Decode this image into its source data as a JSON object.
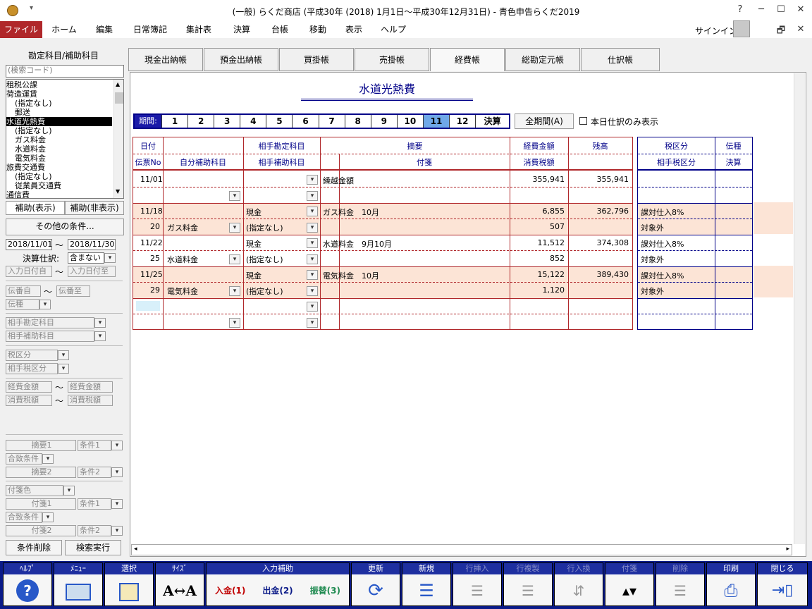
{
  "window": {
    "title": "(一般) らくだ商店 (平成30年 (2018) 1月1日～平成30年12月31日) - 青色申告らくだ2019",
    "buttons": {
      "help": "?",
      "min": "─",
      "max": "☐",
      "close": "✕"
    }
  },
  "menubar": {
    "items": [
      "ファイル",
      "ホーム",
      "編集",
      "日常簿記",
      "集計表",
      "決算",
      "台帳",
      "移動",
      "表示",
      "ヘルプ"
    ],
    "signin": "サインイン",
    "restore": "🗗",
    "close": "✕"
  },
  "left": {
    "header": "勘定科目/補助科目",
    "search_placeholder": "(検索コード)",
    "accounts": [
      "租税公課",
      "荷造運賃",
      "(指定なし)",
      "郵送",
      "水道光熱費",
      "(指定なし)",
      "ガス料金",
      "水道料金",
      "電気料金",
      "旅費交通費",
      "(指定なし)",
      "従業員交通費",
      "通信費"
    ],
    "selected_index": 4,
    "tab_show": "補助(表示)",
    "tab_hide": "補助(非表示)",
    "other_conditions": "その他の条件...",
    "date_from": "2018/11/01",
    "date_to": "2018/11/30",
    "tilde": "～",
    "kessan_label": "決算仕訳:",
    "kessan_value": "含まない",
    "input_date_from": "入力日付自",
    "input_date_to": "入力日付至",
    "denban_from": "伝番自",
    "denban_to": "伝番至",
    "denshu": "伝種",
    "aite_kamoku": "相手勘定科目",
    "aite_hojo": "相手補助科目",
    "zeikubun": "税区分",
    "aite_zeikubun": "相手税区分",
    "keihi_from": "経費金額",
    "keihi_to": "経費金額",
    "shohizei_from": "消費税額",
    "shohizei_to": "消費税額",
    "tekiyo1": "摘要1",
    "joken1": "条件1",
    "gatchi1": "合致条件",
    "tekiyo2": "摘要2",
    "joken2": "条件2",
    "fusen_color": "付箋色",
    "fusen1": "付箋1",
    "fusen_joken1": "条件1",
    "fusen_gatchi": "合致条件",
    "fusen2": "付箋2",
    "fusen_joken2": "条件2",
    "clear_button": "条件削除",
    "search_button": "検索実行"
  },
  "tabs": [
    "現金出納帳",
    "預金出納帳",
    "買掛帳",
    "売掛帳",
    "経費帳",
    "総勘定元帳",
    "仕訳帳"
  ],
  "active_tab": 4,
  "ledger_title": "水道光熱費",
  "period": {
    "label": "期間:",
    "cells": [
      "1",
      "2",
      "3",
      "4",
      "5",
      "6",
      "7",
      "8",
      "9",
      "10",
      "11",
      "12",
      "決算"
    ],
    "selected": "11",
    "all_button": "全期間(A)",
    "today_only": "本日仕訳のみ表示"
  },
  "headers": {
    "date": "日付",
    "denpyo": "伝票No",
    "self_hojo": "自分補助科目",
    "aite_kamoku": "相手勘定科目",
    "aite_hojo": "相手補助科目",
    "tekiyo": "摘要",
    "fusen": "付箋",
    "keihi": "経費金額",
    "shohizei": "消費税額",
    "zandaka": "残高",
    "zeikubun": "税区分",
    "aite_zeikubun": "相手税区分",
    "denshu": "伝種",
    "kessan": "決算"
  },
  "rows": [
    {
      "date": "11/01",
      "no": "",
      "self_hojo": "",
      "aite": "",
      "aite_hojo": "",
      "tekiyo": "繰越金額",
      "keihi": "355,941",
      "tax": "",
      "balance": "355,941",
      "zei": "",
      "aite_zei": ""
    },
    {
      "date": "11/18",
      "no": "20",
      "self_hojo": "ガス料金",
      "aite": "現金",
      "aite_hojo": "(指定なし)",
      "tekiyo": "ガス料金　10月",
      "keihi": "6,855",
      "tax": "507",
      "balance": "362,796",
      "zei": "課対仕入8%",
      "aite_zei": "対象外"
    },
    {
      "date": "11/22",
      "no": "25",
      "self_hojo": "水道料金",
      "aite": "現金",
      "aite_hojo": "(指定なし)",
      "tekiyo": "水道料金　9月10月",
      "keihi": "11,512",
      "tax": "852",
      "balance": "374,308",
      "zei": "課対仕入8%",
      "aite_zei": "対象外"
    },
    {
      "date": "11/25",
      "no": "29",
      "self_hojo": "電気料金",
      "aite": "現金",
      "aite_hojo": "(指定なし)",
      "tekiyo": "電気料金　10月",
      "keihi": "15,122",
      "tax": "1,120",
      "balance": "389,430",
      "zei": "課対仕入8%",
      "aite_zei": "対象外"
    }
  ],
  "toolbar": {
    "help": "ﾍﾙﾌﾟ",
    "menu": "ﾒﾆｭｰ",
    "select": "選択",
    "size": "ｻｲｽﾞ",
    "input_assist": "入力補助",
    "nyukin": "入金(1)",
    "shukkin": "出金(2)",
    "furikae": "振替(3)",
    "update": "更新",
    "new": "新規",
    "row_insert": "行挿入",
    "row_copy": "行複製",
    "row_swap": "行入換",
    "fusen": "付箋",
    "delete": "削除",
    "print": "印刷",
    "close": "閉じる"
  }
}
